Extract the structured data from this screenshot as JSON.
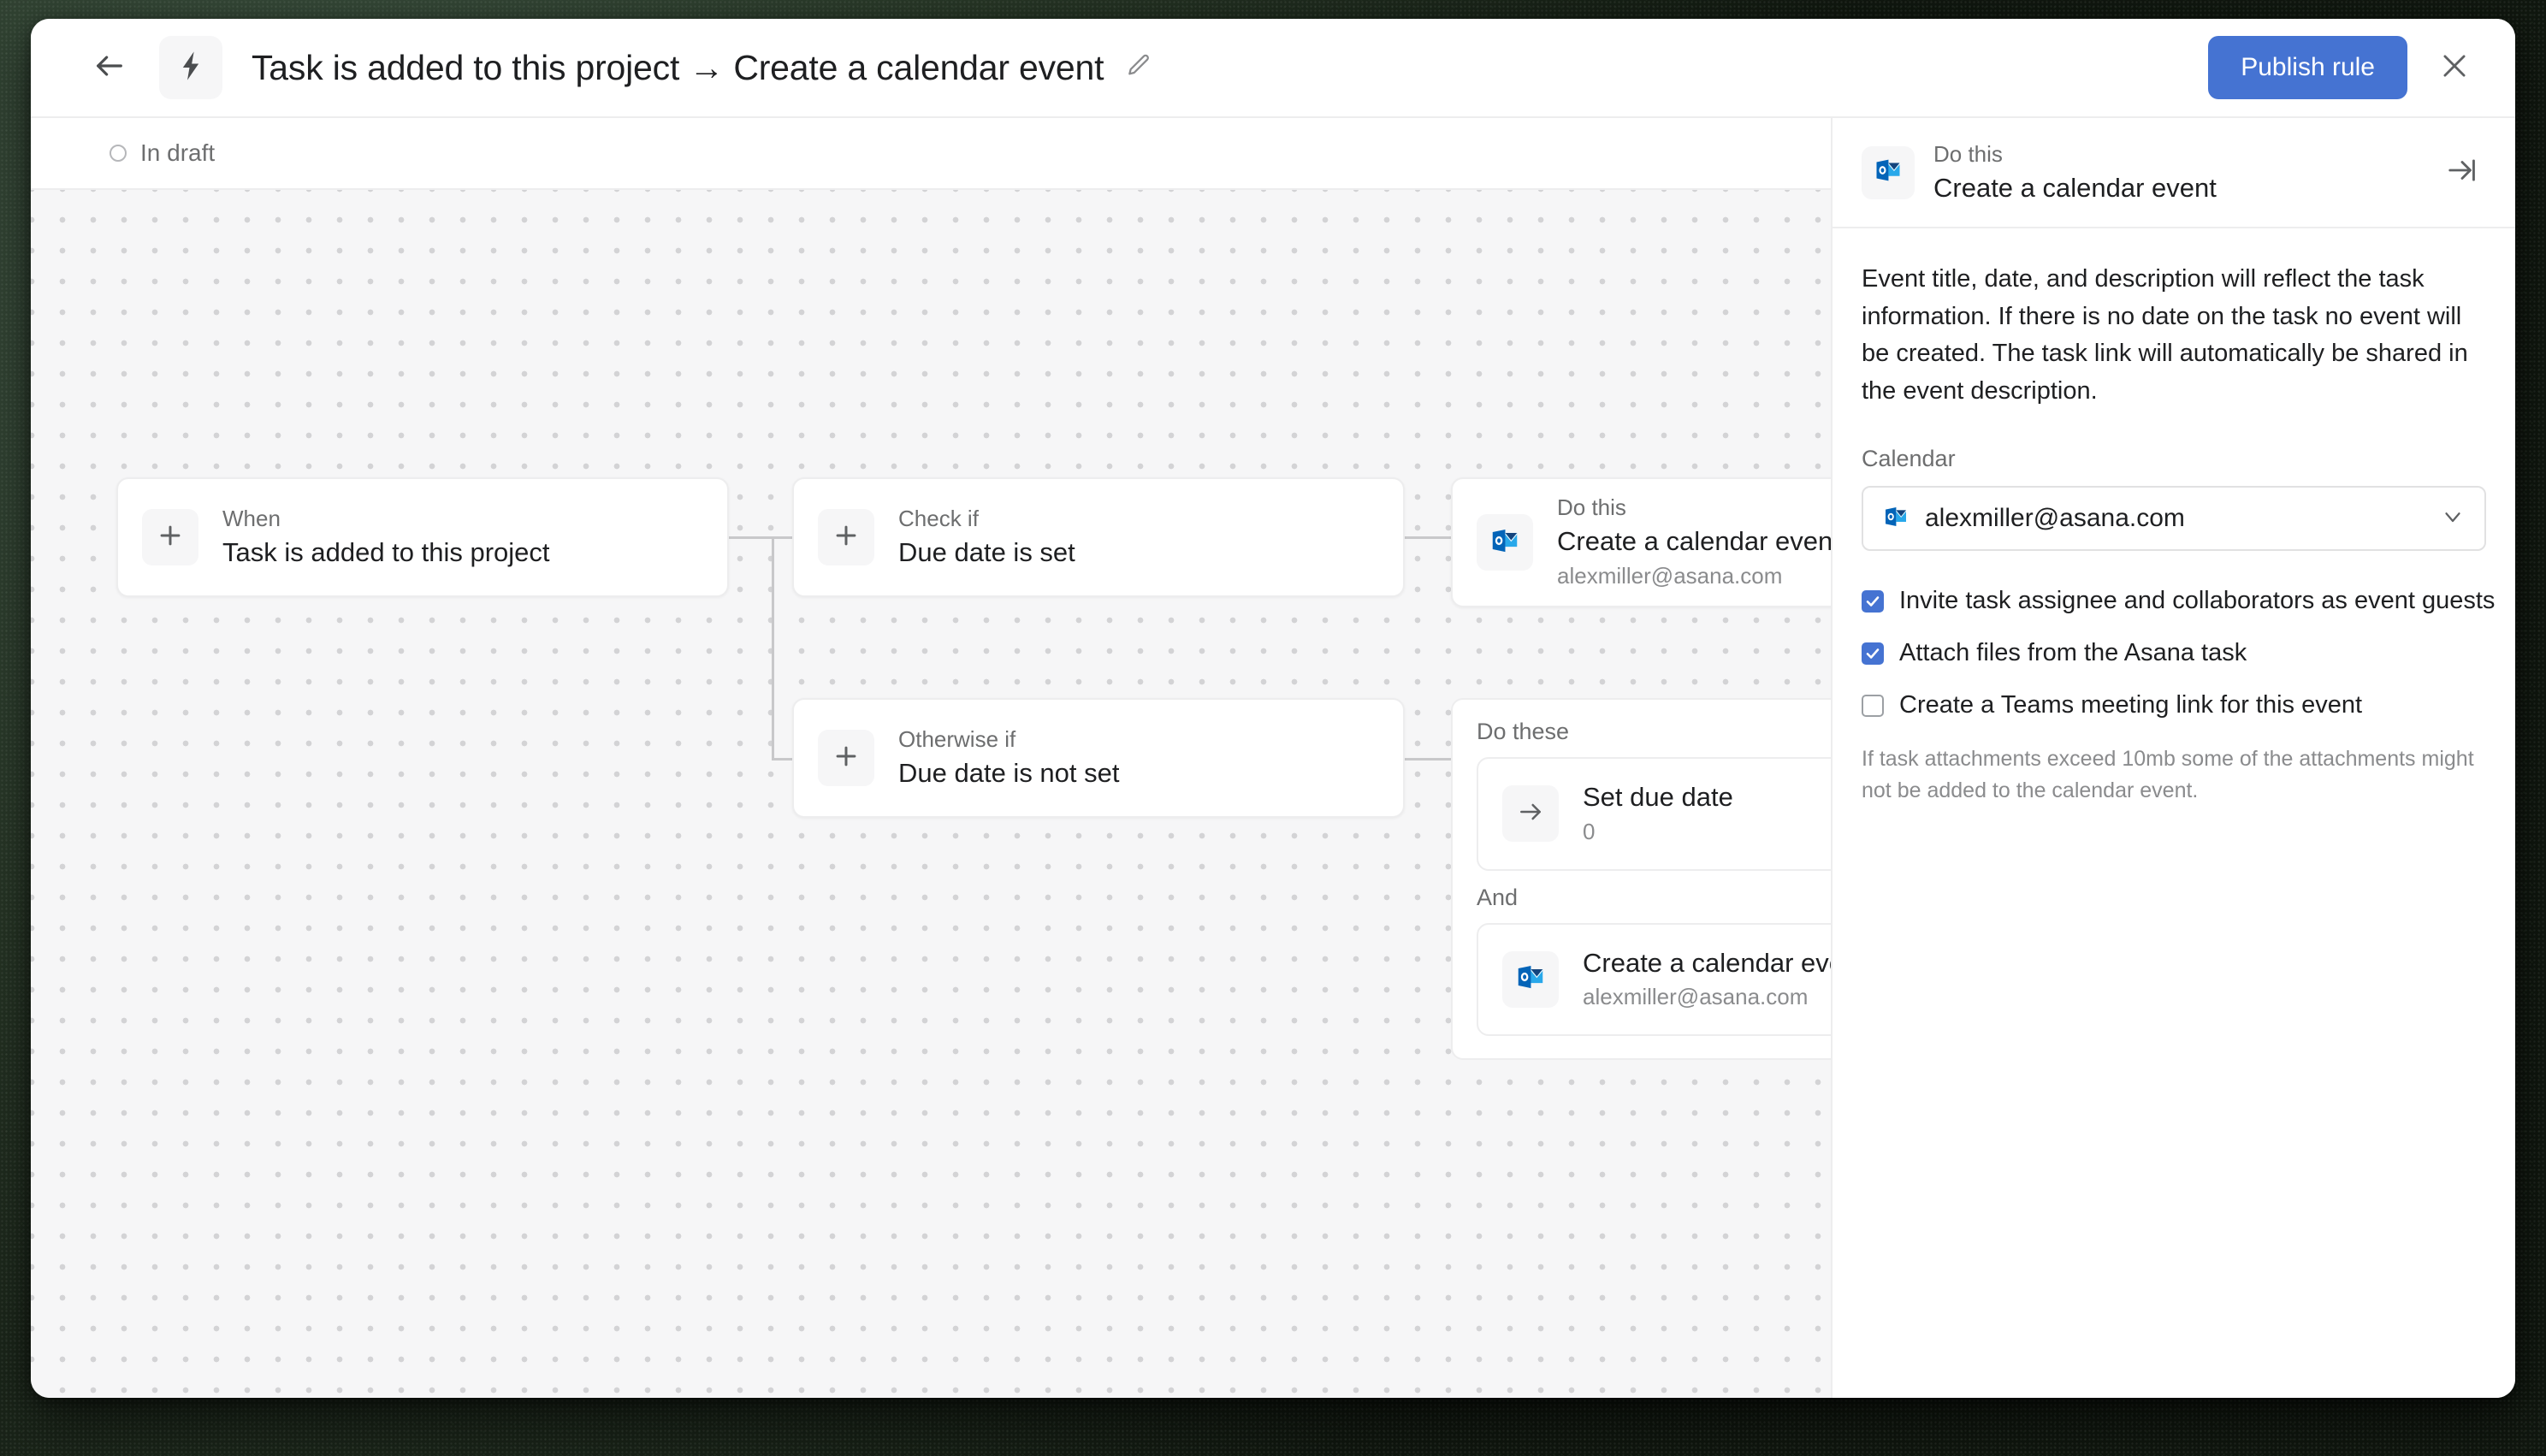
{
  "topbar": {
    "back_icon": "arrow-left-icon",
    "rule_icon": "lightning-bolt-icon",
    "title": "Task is added to this project → Create a calendar event",
    "edit_icon": "pencil-icon",
    "publish_label": "Publish rule",
    "close_icon": "close-icon",
    "publish_color": "#4573d2"
  },
  "status": {
    "label": "In draft",
    "icon": "circle-outline-icon"
  },
  "canvas": {
    "trigger": {
      "kicker": "When",
      "title": "Task is added to this project",
      "icon": "plus-icon"
    },
    "conditions": [
      {
        "kicker": "Check if",
        "title": "Due date is set",
        "icon": "plus-icon"
      },
      {
        "kicker": "Otherwise if",
        "title": "Due date is not set",
        "icon": "plus-icon"
      }
    ],
    "action_single": {
      "kicker": "Do this",
      "title": "Create a calendar event",
      "subtitle": "alexmiller@asana.com",
      "icon": "outlook-icon"
    },
    "action_group": {
      "label": "Do these",
      "and_label": "And",
      "actions": [
        {
          "title": "Set due date",
          "subtitle": "0",
          "icon": "arrow-right-icon"
        },
        {
          "title": "Create a calendar event",
          "subtitle": "alexmiller@asana.com",
          "icon": "outlook-icon"
        }
      ]
    }
  },
  "panel": {
    "header": {
      "kicker": "Do this",
      "title": "Create a calendar event",
      "icon": "outlook-icon",
      "collapse_icon": "collapse-right-icon"
    },
    "description": "Event title, date, and description will reflect the task information. If there is no date on the task no event will be created. The task link will automatically be shared in the event description.",
    "calendar_label": "Calendar",
    "calendar_value": "alexmiller@asana.com",
    "calendar_icon": "outlook-icon",
    "chevron_icon": "chevron-down-icon",
    "options": [
      {
        "label": "Invite task assignee and collaborators as event guests",
        "checked": true
      },
      {
        "label": "Attach files from the Asana task",
        "checked": true
      },
      {
        "label": "Create a Teams meeting link for this event",
        "checked": false
      }
    ],
    "note": "If task attachments exceed 10mb some of the attachments might not be added to the calendar event."
  }
}
